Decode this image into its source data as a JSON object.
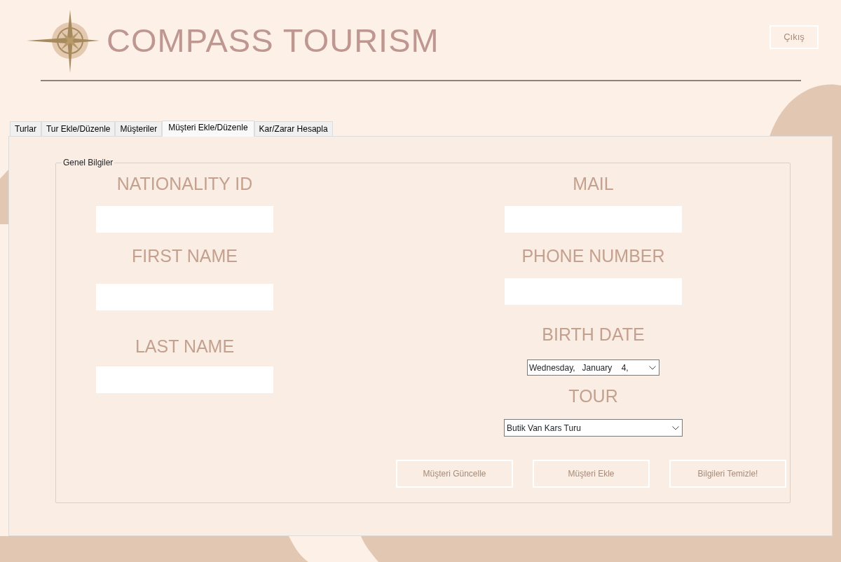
{
  "header": {
    "title": "COMPASS TOURISM",
    "logout_button": "Çıkış"
  },
  "tabs": [
    {
      "label": "Turlar",
      "selected": false
    },
    {
      "label": "Tur Ekle/Düzenle",
      "selected": false
    },
    {
      "label": "Müşteriler",
      "selected": false
    },
    {
      "label": "Müşteri Ekle/Düzenle",
      "selected": true
    },
    {
      "label": "Kar/Zarar Hesapla",
      "selected": false
    }
  ],
  "group": {
    "title": "Genel Bilgiler",
    "left_fields": [
      {
        "label": "NATIONALITY ID",
        "kind": "text"
      },
      {
        "label": "FIRST NAME",
        "kind": "text"
      },
      {
        "label": "LAST NAME",
        "kind": "text"
      }
    ],
    "right_fields": [
      {
        "label": "MAIL",
        "kind": "text"
      },
      {
        "label": "PHONE NUMBER",
        "kind": "text"
      },
      {
        "label": "BIRTH DATE",
        "kind": "date",
        "value": "Wednesday,   January    4,"
      },
      {
        "label": "TOUR",
        "kind": "select",
        "value": "Butik Van Kars Turu"
      }
    ],
    "buttons": [
      "Müşteri Güncelle",
      "Müşteri Ekle",
      "Bilgileri Temizle!"
    ]
  }
}
